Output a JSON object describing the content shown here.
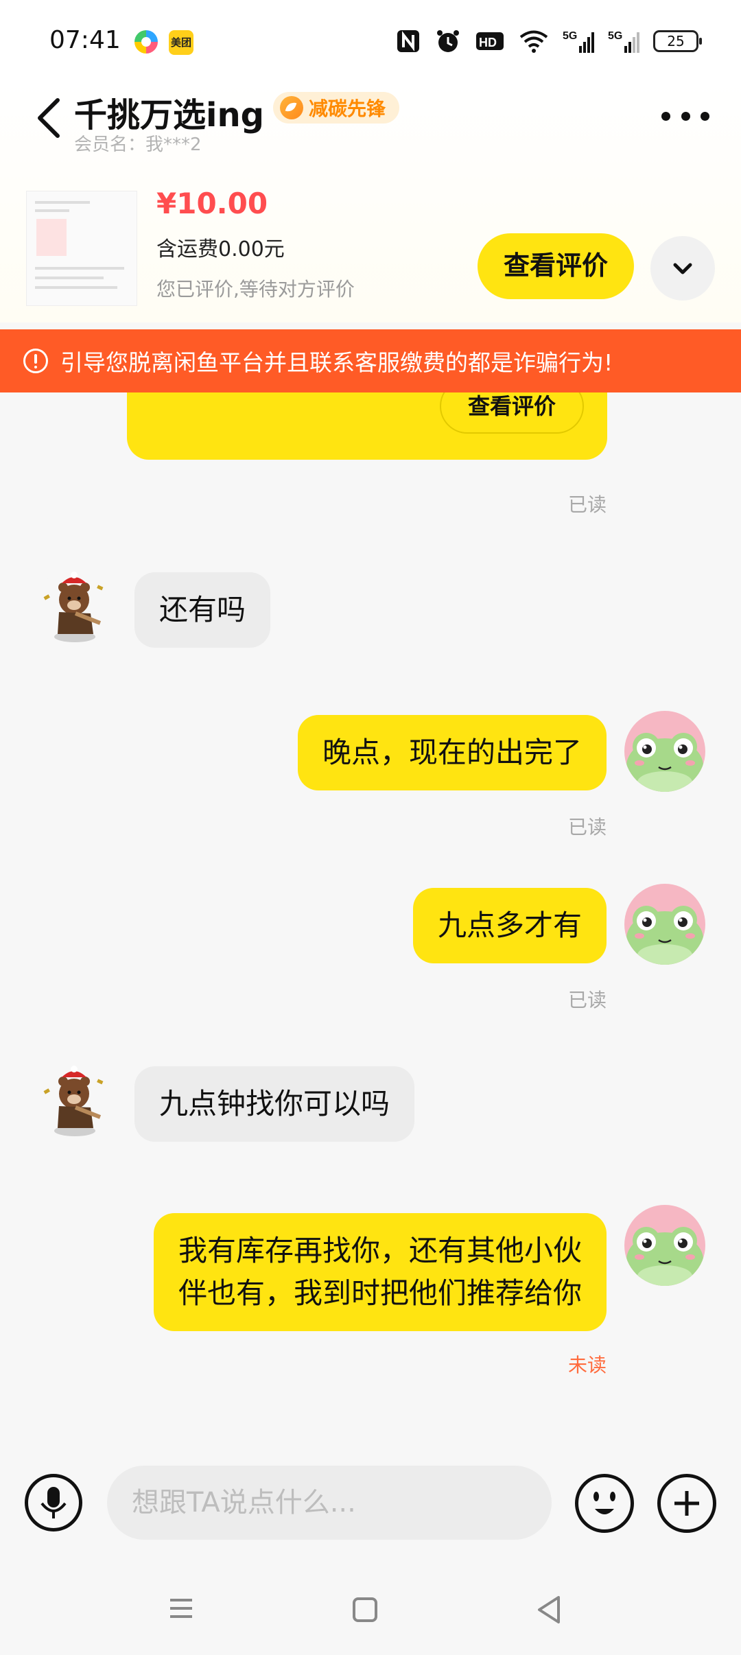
{
  "status_bar": {
    "time": "07:41",
    "app_badge": "美团",
    "battery": "25",
    "icons": [
      "nfc-icon",
      "alarm-icon",
      "hd-icon",
      "wifi-icon",
      "signal-5g-icon",
      "signal-5g-icon",
      "battery-icon"
    ]
  },
  "header": {
    "shop_name": "千挑万选ing",
    "badge_label": "减碳先锋",
    "member_label": "会员名：我***2",
    "icons": [
      "back-icon",
      "leaf-icon",
      "more-icon"
    ]
  },
  "product": {
    "price": "¥10.00",
    "shipping": "含运费0.00元",
    "review_status": "您已评价,等待对方评价",
    "review_button": "查看评价"
  },
  "warning": {
    "text": "引导您脱离闲鱼平台并且联系客服缴费的都是诈骗行为!"
  },
  "chat": {
    "card_review_button": "查看评价",
    "messages": [
      {
        "side": "status",
        "text": "已读"
      },
      {
        "side": "in",
        "text": "还有吗"
      },
      {
        "side": "out",
        "text": "晚点，现在的出完了",
        "status": "已读"
      },
      {
        "side": "out",
        "text": "九点多才有",
        "status": "已读"
      },
      {
        "side": "in",
        "text": "九点钟找你可以吗"
      },
      {
        "side": "out",
        "lines": [
          "我有库存再找你，还有其他小伙",
          "伴也有，我到时把他们推荐给你"
        ],
        "status": "未读"
      }
    ]
  },
  "input": {
    "placeholder": "想跟TA说点什么..."
  },
  "colors": {
    "accent_yellow": "#ffe411",
    "warning_orange": "#ff5b26",
    "price_red": "#ff4d4f",
    "unread": "#ff6b3d"
  }
}
